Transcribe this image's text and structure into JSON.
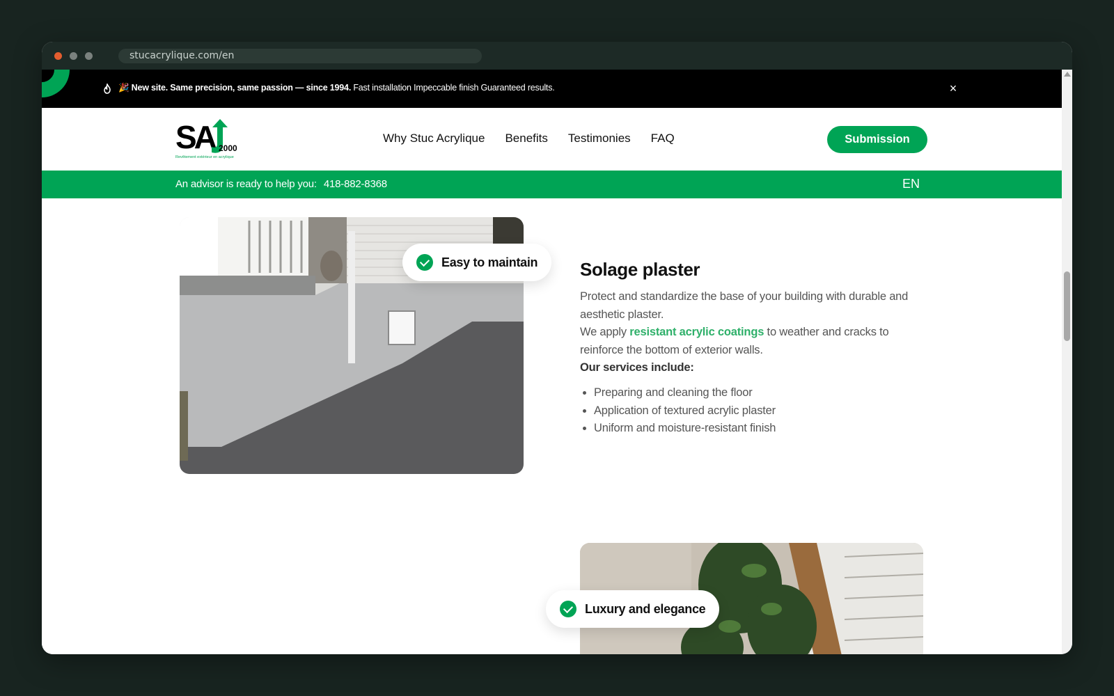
{
  "browser": {
    "url": "stucacrylique.com/en"
  },
  "announcement": {
    "bold_text": "🎉 New site. Same precision, same passion — since 1994.",
    "rest_text": " Fast installation Impeccable finish Guaranteed results.",
    "close_label": "×"
  },
  "nav": {
    "logo_alt": "SAJ 2000 — Revêtement extérieur en acrylique",
    "links": [
      "Why Stuc Acrylique",
      "Benefits",
      "Testimonies",
      "FAQ"
    ],
    "cta": "Submission"
  },
  "contact_bar": {
    "advisor_text": "An advisor is ready to help you:",
    "phone": "418-882-8368",
    "language": "EN"
  },
  "section1": {
    "badge": "Easy to maintain",
    "title": "Solage plaster",
    "paragraph1": "Protect and standardize the base of your building with durable and aesthetic plaster.",
    "paragraph2_before": "We apply ",
    "paragraph2_link": "resistant acrylic coatings",
    "paragraph2_after": " to weather and cracks to reinforce the bottom of exterior walls.",
    "services_heading": "Our services include:",
    "services": [
      "Preparing and cleaning the floor",
      "Application of textured acrylic plaster",
      "Uniform and moisture-resistant finish"
    ]
  },
  "section2": {
    "badge": "Luxury and elegance"
  },
  "colors": {
    "brand_green": "#00a455",
    "link_green": "#2fb06a",
    "announcement_bg": "#000000"
  },
  "icons": {
    "flame": "flame-icon",
    "close": "close-icon",
    "check": "check-circle-icon"
  }
}
